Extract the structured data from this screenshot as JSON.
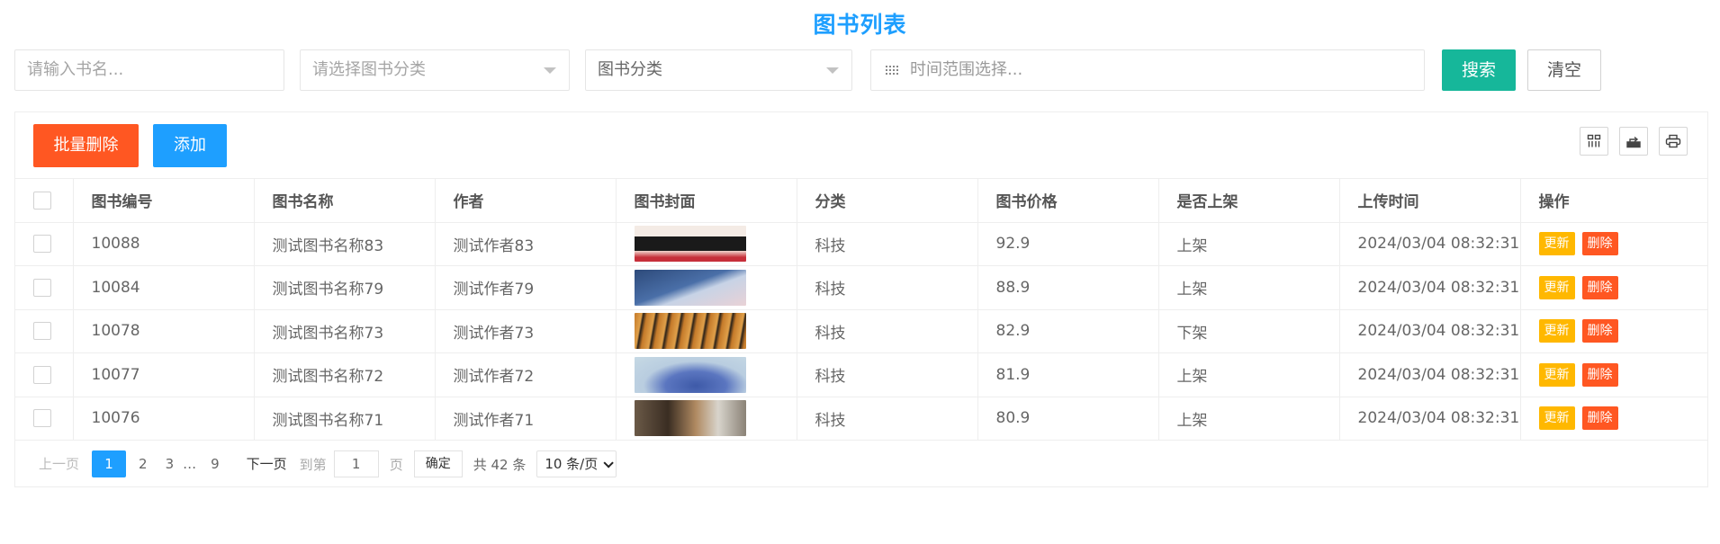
{
  "title": "图书列表",
  "filters": {
    "name_placeholder": "请输入书名...",
    "category_select_placeholder": "请选择图书分类",
    "category_select2_value": "图书分类",
    "date_range_placeholder": "时间范围选择..."
  },
  "buttons": {
    "search": "搜索",
    "clear": "清空",
    "batch_delete": "批量删除",
    "add": "添加",
    "row_update": "更新",
    "row_delete": "删除"
  },
  "toolbar_icons": [
    "grid-columns-icon",
    "export-icon",
    "print-icon"
  ],
  "columns": [
    "图书编号",
    "图书名称",
    "作者",
    "图书封面",
    "分类",
    "图书价格",
    "是否上架",
    "上传时间",
    "操作"
  ],
  "rows": [
    {
      "id": "10088",
      "name": "测试图书名称83",
      "author": "测试作者83",
      "category": "科技",
      "price": "92.9",
      "status": "上架",
      "time": "2024/03/04 08:32:31"
    },
    {
      "id": "10084",
      "name": "测试图书名称79",
      "author": "测试作者79",
      "category": "科技",
      "price": "88.9",
      "status": "上架",
      "time": "2024/03/04 08:32:31"
    },
    {
      "id": "10078",
      "name": "测试图书名称73",
      "author": "测试作者73",
      "category": "科技",
      "price": "82.9",
      "status": "下架",
      "time": "2024/03/04 08:32:31"
    },
    {
      "id": "10077",
      "name": "测试图书名称72",
      "author": "测试作者72",
      "category": "科技",
      "price": "81.9",
      "status": "上架",
      "time": "2024/03/04 08:32:31"
    },
    {
      "id": "10076",
      "name": "测试图书名称71",
      "author": "测试作者71",
      "category": "科技",
      "price": "80.9",
      "status": "上架",
      "time": "2024/03/04 08:32:31"
    }
  ],
  "pager": {
    "prev": "上一页",
    "pages": [
      "1",
      "2",
      "3"
    ],
    "ellipsis": "…",
    "last_page": "9",
    "next": "下一页",
    "goto_label": "到第",
    "goto_value": "1",
    "page_unit": "页",
    "confirm": "确定",
    "total": "共 42 条",
    "page_size": "10 条/页"
  },
  "colors": {
    "primary": "#1e9fff",
    "success": "#16b79a",
    "danger": "#ff5722",
    "warning": "#ffb800"
  }
}
